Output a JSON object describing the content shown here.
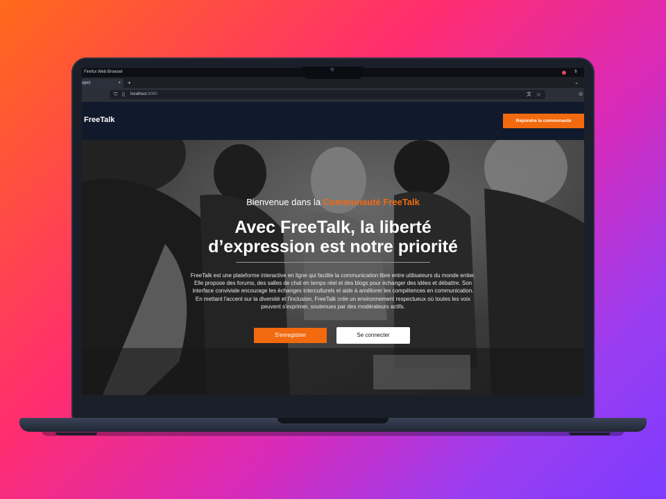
{
  "browser": {
    "window_title": "Firefox Web Browser",
    "language": "fr",
    "tab_label": "oject",
    "tab_close": "×",
    "new_tab": "+",
    "tab_menu": "⌄",
    "url_host": "localhost",
    "url_port": ":8080"
  },
  "site": {
    "logo": "FreeTalk",
    "join_button": "Rejoindre la communauté",
    "accent_color": "#f26a0f",
    "header_color": "#111a2c"
  },
  "hero": {
    "welcome_prefix": "Bienvenue dans la",
    "welcome_accent": "Communauté FreeTalk",
    "title_line1": "Avec FreeTalk, la liberté",
    "title_line2": "d’expression est notre priorité",
    "description": "FreeTalk est une plateforme interactive en ligne qui facilite la communication libre entre utilisateurs du monde entier. Elle propose des forums, des salles de chat en temps réel et des blogs pour échanger des idées et débattre. Son interface conviviale encourage les échanges interculturels et aide à améliorer les compétences en communication. En mettant l'accent sur la diversité et l'inclusion, FreeTalk crée un environnement respectueux où toutes les voix peuvent s'exprimer, soutenues par des modérateurs actifs.",
    "register_button": "S'enregistrer",
    "login_button": "Se connecter"
  }
}
